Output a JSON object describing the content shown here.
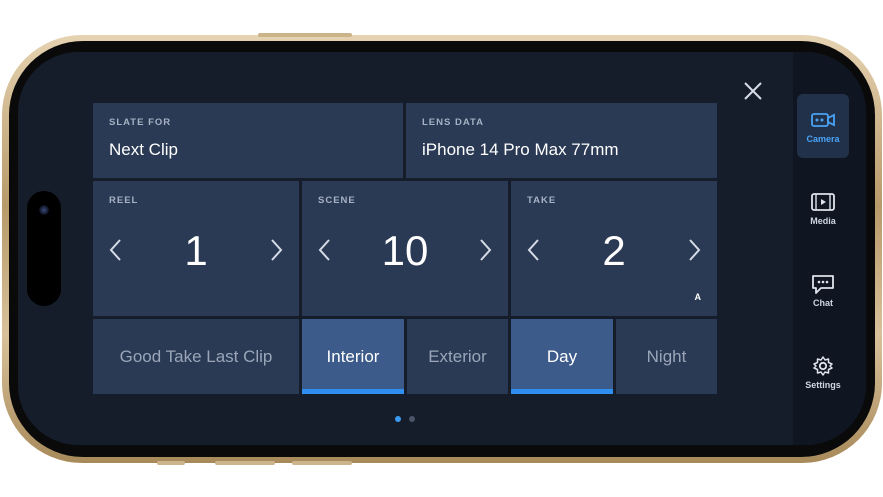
{
  "slate": {
    "slate_for_label": "SLATE FOR",
    "slate_for_value": "Next Clip",
    "lens_label": "LENS DATA",
    "lens_value": "iPhone 14 Pro Max 77mm"
  },
  "counters": {
    "reel": {
      "label": "REEL",
      "value": "1"
    },
    "scene": {
      "label": "SCENE",
      "value": "10"
    },
    "take": {
      "label": "TAKE",
      "value": "2",
      "suffix": "A"
    }
  },
  "toggles": {
    "good_take": "Good Take Last Clip",
    "interior": "Interior",
    "exterior": "Exterior",
    "day": "Day",
    "night": "Night"
  },
  "sidebar": {
    "camera": "Camera",
    "media": "Media",
    "chat": "Chat",
    "settings": "Settings"
  },
  "pager": {
    "pages": 2,
    "active": 1
  },
  "colors": {
    "accent": "#2f8ff0",
    "panel": "#2a3954",
    "active_toggle": "#3c5a8a",
    "background": "#151d2a"
  }
}
